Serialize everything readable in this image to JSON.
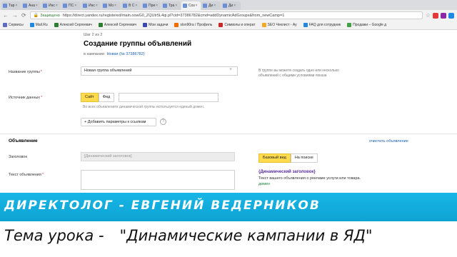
{
  "tabs": [
    {
      "label": "Тар"
    },
    {
      "label": "Ана"
    },
    {
      "label": "Инс"
    },
    {
      "label": "ПС"
    },
    {
      "label": "Инс"
    },
    {
      "label": "Мо"
    },
    {
      "label": "В С"
    },
    {
      "label": "При"
    },
    {
      "label": "Тра"
    },
    {
      "label": "Соз",
      "active": true
    },
    {
      "label": "Ди"
    },
    {
      "label": "Ди"
    }
  ],
  "tab_close_symbol": "×",
  "browser": {
    "secure_label": "Защищено",
    "url": "https://direct.yandex.ru/registered/main.oowG0_ZQUtr5L4qi.pl?cid=37386782&cmd=addDynamicAdGroups&from_newCamp=1"
  },
  "bookmarks": [
    {
      "label": "Сервисы",
      "color": "#5c6bc0"
    },
    {
      "label": "Mail.Ru",
      "color": "#1e88e5"
    },
    {
      "label": "Алексей Сергеевич",
      "color": "#2e7d32"
    },
    {
      "label": "Алексей Сергеевич",
      "color": "#2e7d32"
    },
    {
      "label": "Мои задачи",
      "color": "#3949ab"
    },
    {
      "label": "slon90ra / Профиль",
      "color": "#ef6c00"
    },
    {
      "label": "Символы и операт",
      "color": "#c62828"
    },
    {
      "label": "SEO Чеклист - Ау",
      "color": "#f9a825"
    },
    {
      "label": "FAQ для сотрудник",
      "color": "#1e88e5"
    },
    {
      "label": "Продажи – Google д",
      "color": "#43a047"
    }
  ],
  "form": {
    "step": "Шаг 2 из 2",
    "title": "Создание группы объявлений",
    "campaign_prefix": "в кампании",
    "campaign_link": "Новая (№ 37386782)",
    "group_name_label": "Название группы",
    "group_name_value": "Новая группа объявлений",
    "group_name_hint": "В группе вы можете создать одно или несколько объявлений с общими условиями показа",
    "source_label": "Источник данных",
    "source_options": [
      "Сайт",
      "Фид"
    ],
    "source_selected": "Сайт",
    "source_hint": "Во всех объявлениях динамической группы используется единый домен.",
    "add_params_button": "+ Добавить параметры к ссылкам",
    "help_symbol": "?",
    "ad_section": "Объявление",
    "fill_ad_link": "очистить объявление",
    "title_label": "Заголовок",
    "title_placeholder": "[Динамический заголовок]",
    "text_label": "Текст объявления",
    "view_options": [
      "Базовый вид",
      "На поиске"
    ],
    "view_selected": "Базовый вид",
    "preview_title": "{Динамический заголовок}",
    "preview_text": "Текст вашего объявления о рекламе услуги или товара.",
    "preview_domain": "домен"
  },
  "overlay": {
    "banner": "ДИРЕКТОЛОГ - ЕВГЕНИЙ ВЕДЕРНИКОВ",
    "lesson_prefix": "Тема урока -",
    "lesson_topic": "\"Динамические кампании в ЯД\""
  },
  "colors": {
    "banner": "#17b6e6",
    "accent_yellow": "#ffdb4d",
    "link": "#1a5fb4"
  }
}
